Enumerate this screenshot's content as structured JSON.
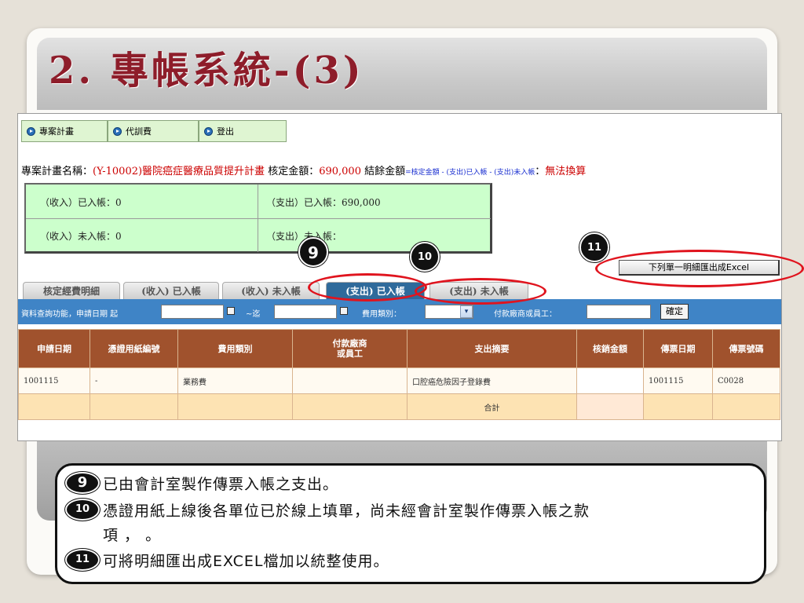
{
  "slide_title": "2. 專帳系統-(3)",
  "nav": [
    {
      "label": "專案計畫"
    },
    {
      "label": "代訓費"
    },
    {
      "label": "登出"
    }
  ],
  "project": {
    "name_label": "專案計畫名稱：",
    "name_value": "(Y-10002)醫院癌症醫療品質提升計畫",
    "approved_label": "核定金額：",
    "approved_value": "690,000",
    "balance_label": "結餘金額",
    "balance_formula": "=核定金額 - (支出)已入帳 - (支出)未入帳",
    "balance_sep": "：",
    "balance_value": "無法換算"
  },
  "summary": {
    "income_posted": "（收入）已入帳：0",
    "expense_posted": "（支出）已入帳：690,000",
    "income_unposted": "（收入）未入帳：0",
    "expense_unposted": "（支出）未入帳："
  },
  "tabs": [
    "核定經費明細",
    "(收入) 已入帳",
    "(收入) 未入帳",
    "(支出) 已入帳",
    "(支出) 未入帳"
  ],
  "export_button": "下列單一明細匯出成Excel",
  "filter": {
    "label_date_from": "資料查詢功能，申請日期 起",
    "label_to": "~迄",
    "label_category": "費用類別：",
    "label_vendor": "付款廠商或員工：",
    "confirm": "確定"
  },
  "table": {
    "headers": [
      "申請日期",
      "憑證用紙編號",
      "費用類別",
      "付款廠商\n或員工",
      "支出摘要",
      "核銷金額",
      "傳票日期",
      "傳票號碼"
    ],
    "rows": [
      [
        "1001115",
        "-",
        "業務費",
        "",
        "口腔癌危險因子登錄費",
        "",
        "1001115",
        "C0028"
      ]
    ],
    "total_label": "合計"
  },
  "callouts": [
    "9",
    "10",
    "11"
  ],
  "notes": [
    {
      "num": "9",
      "text": "已由會計室製作傳票入帳之支出。"
    },
    {
      "num": "10",
      "text": "憑證用紙上線後各單位已於線上填單，尚未經會計室製作傳票入帳之款"
    },
    {
      "num": "",
      "text": "項 ， 。"
    },
    {
      "num": "11",
      "text": "可將明細匯出成EXCEL檔加以統整使用。"
    }
  ]
}
